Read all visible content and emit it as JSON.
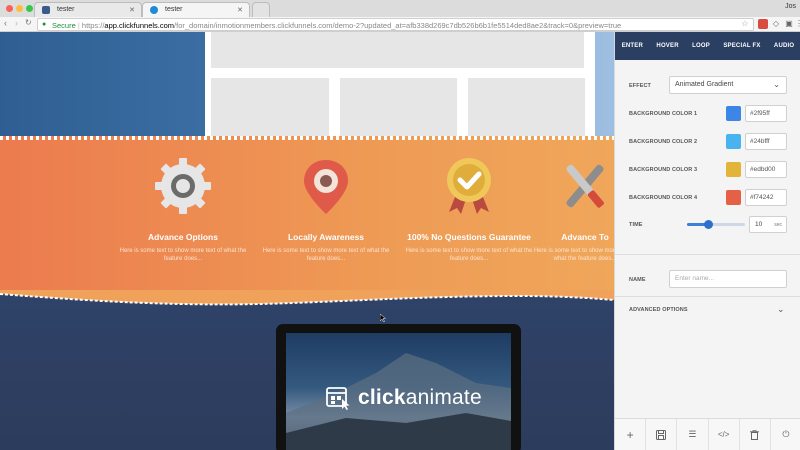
{
  "browser": {
    "tabs": [
      {
        "title": "tester"
      },
      {
        "title": "tester"
      }
    ],
    "user": "Jos",
    "address": {
      "secure_label": "Secure",
      "separator": "|",
      "scheme": "https://",
      "domain": "app.clickfunnels.com",
      "path": "/for_domain/inmotionmembers.clickfunnels.com/demo-2?updated_at=afb338d269c7db526b6b1fe5514ded8ae2&track=0&preview=true"
    }
  },
  "canvas": {
    "features": [
      {
        "icon": "gear-icon",
        "title": "Advance Options",
        "desc": "Here is some text to show more text of what the feature does..."
      },
      {
        "icon": "map-pin-icon",
        "title": "Locally Awareness",
        "desc": "Here is some text to show more text of what the feature does..."
      },
      {
        "icon": "award-ribbon-icon",
        "title": "100% No Questions Guarantee",
        "desc": "Here is some text to show more text of what the feature does..."
      },
      {
        "icon": "wrench-screwdriver-icon",
        "title": "Advance To",
        "desc": "Here is some text to show more text of what the feature does..."
      }
    ],
    "logo": {
      "part1": "click",
      "part2": "animate"
    }
  },
  "panel": {
    "tabs": [
      "ENTER",
      "HOVER",
      "LOOP",
      "SPECIAL FX",
      "AUDIO"
    ],
    "effect": {
      "label": "EFFECT",
      "value": "Animated Gradient"
    },
    "colors": [
      {
        "label": "BACKGROUND COLOR 1",
        "hex": "#2f95ff",
        "swatch": "#3b86e6"
      },
      {
        "label": "BACKGROUND COLOR 2",
        "hex": "#24bfff",
        "swatch": "#49b3f0"
      },
      {
        "label": "BACKGROUND COLOR 3",
        "hex": "#edbd00",
        "swatch": "#e2b43a"
      },
      {
        "label": "BACKGROUND COLOR 4",
        "hex": "#f74242",
        "swatch": "#e66048"
      }
    ],
    "time": {
      "label": "TIME",
      "value": "10",
      "unit": "sec",
      "slider_fraction": 0.36
    },
    "name": {
      "label": "NAME",
      "placeholder": "Enter name..."
    },
    "advanced_label": "ADVANCED OPTIONS",
    "footer_icons": [
      "plus-icon",
      "save-icon",
      "menu-icon",
      "code-icon",
      "trash-icon",
      "power-icon"
    ]
  },
  "colors": {
    "orange": "#ec7b4e",
    "navy": "#2a3f62",
    "accent": "#2f6fcd"
  }
}
